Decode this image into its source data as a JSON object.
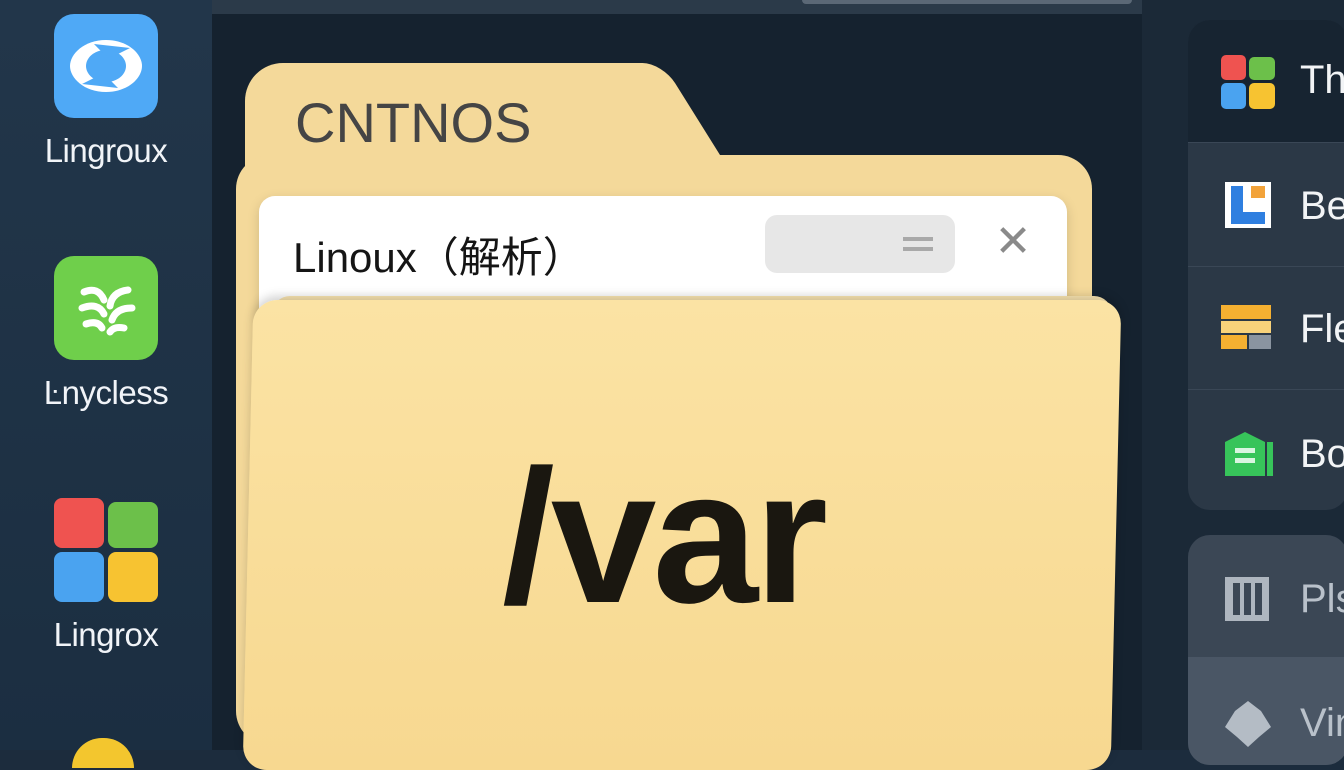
{
  "dock": {
    "items": [
      {
        "label": "Lingroux",
        "icon": "swirl-app-icon",
        "color": "#4aa8f5"
      },
      {
        "label": "Ŀnycless",
        "icon": "leaf-app-icon",
        "color": "#6fcf4b"
      },
      {
        "label": "Lingrox",
        "icon": "windows-grid-icon",
        "color": "#ffffff"
      }
    ]
  },
  "window": {
    "folder_title": "CNTNOS",
    "dialog_title": "Linoux（解析）",
    "path_label": "/var",
    "close_glyph": "✕"
  },
  "right_panel": {
    "items": [
      {
        "label": "Th",
        "icon": "windows-grid-icon",
        "active": true
      },
      {
        "label": "Be",
        "icon": "blue-bracket-icon",
        "active": false
      },
      {
        "label": "Fle",
        "icon": "folder-stack-icon",
        "active": false
      },
      {
        "label": "Bo",
        "icon": "green-book-icon",
        "active": false
      }
    ],
    "secondary_items": [
      {
        "label": "Pls",
        "icon": "columns-icon"
      },
      {
        "label": "Vin",
        "icon": "shape-icon"
      }
    ]
  },
  "colors": {
    "folder": "#f4d99a",
    "background": "#15222f",
    "dock": "#1e3245"
  }
}
